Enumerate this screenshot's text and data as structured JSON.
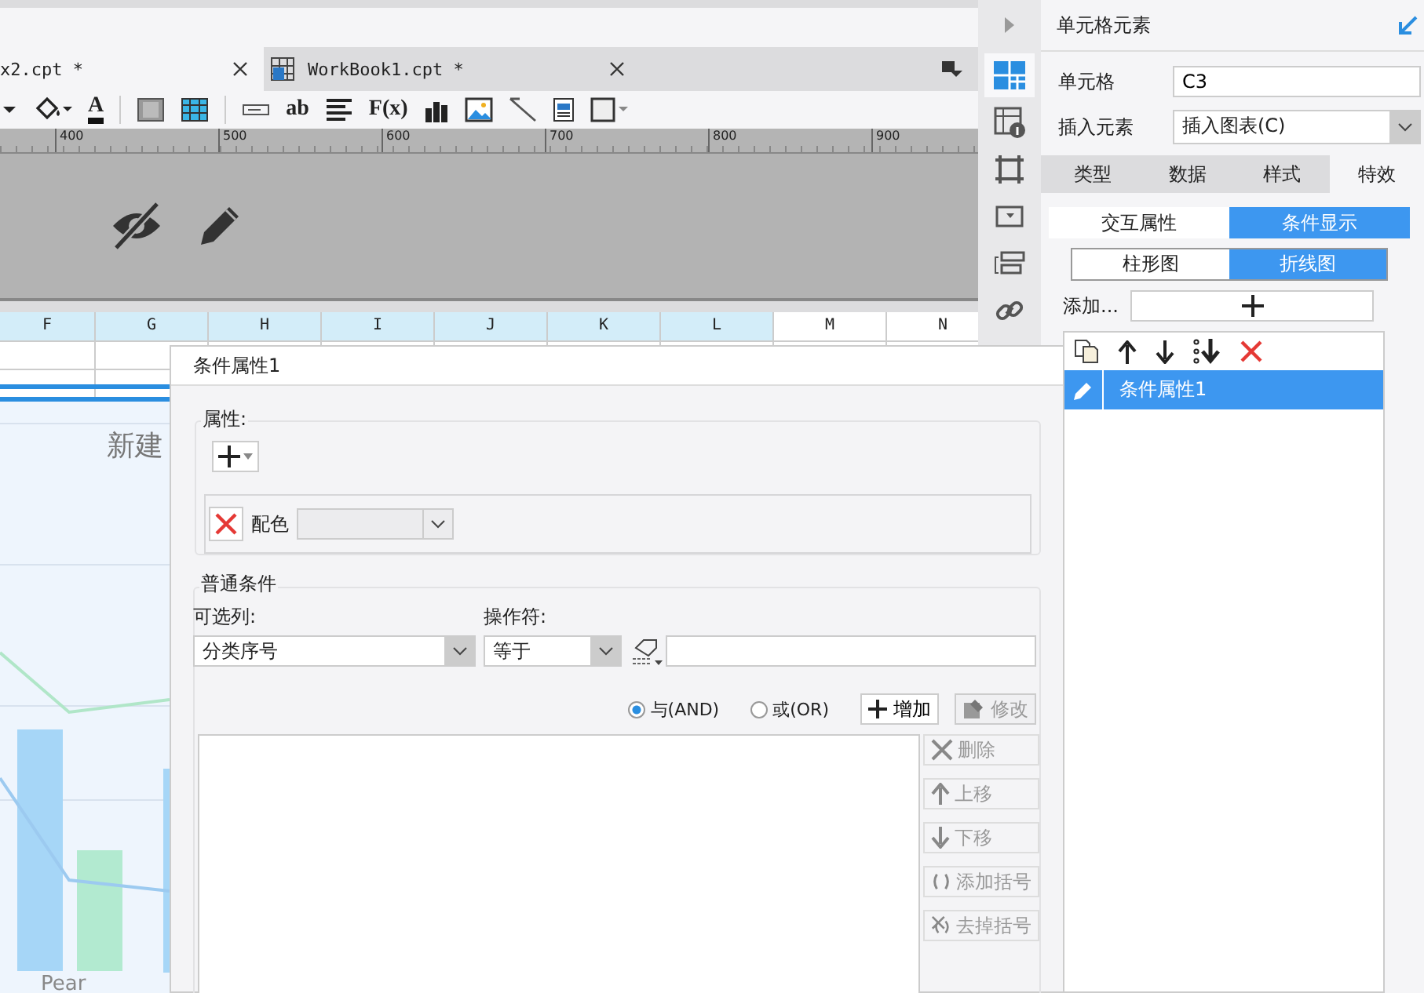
{
  "tabs": [
    {
      "label": "x2.cpt *",
      "selected": true
    },
    {
      "label": "WorkBook1.cpt *",
      "selected": false
    }
  ],
  "toolbar": [
    {
      "kind": "caret"
    },
    {
      "kind": "bucket"
    },
    {
      "kind": "text",
      "glyph": "A"
    },
    {
      "kind": "sep"
    },
    {
      "kind": "merge"
    },
    {
      "kind": "grid"
    },
    {
      "kind": "sep"
    },
    {
      "kind": "textfield"
    },
    {
      "kind": "text",
      "glyph": "ab"
    },
    {
      "kind": "align"
    },
    {
      "kind": "text",
      "glyph": "F(x)"
    },
    {
      "kind": "bars"
    },
    {
      "kind": "image"
    },
    {
      "kind": "slash"
    },
    {
      "kind": "doc"
    },
    {
      "kind": "border"
    }
  ],
  "ruler": [
    "400",
    "500",
    "600",
    "700",
    "800",
    "900"
  ],
  "columns": [
    {
      "label": "F",
      "selected": true
    },
    {
      "label": "G",
      "selected": true
    },
    {
      "label": "H",
      "selected": true
    },
    {
      "label": "I",
      "selected": true
    },
    {
      "label": "J",
      "selected": true
    },
    {
      "label": "K",
      "selected": true
    },
    {
      "label": "L",
      "selected": true
    },
    {
      "label": "M",
      "selected": false
    },
    {
      "label": "N",
      "selected": false
    }
  ],
  "chart": {
    "title": "新建",
    "category": "Pear"
  },
  "dialog": {
    "title": "条件属性1",
    "attributes": {
      "legend": "属性:",
      "color_label": "配色"
    },
    "condition": {
      "legend": "普通条件",
      "column_label": "可选列:",
      "column_value": "分类序号",
      "operator_label": "操作符:",
      "operator_value": "等于"
    },
    "logic": [
      {
        "label": "与(AND)",
        "selected": true
      },
      {
        "label": "或(OR)",
        "selected": false
      }
    ],
    "add_button": "增加",
    "modify_button": {
      "label": "修改",
      "disabled": true
    },
    "side_buttons": [
      {
        "kind": "delete",
        "label": "删除",
        "disabled": true
      },
      {
        "kind": "up",
        "label": "上移",
        "disabled": true
      },
      {
        "kind": "down",
        "label": "下移",
        "disabled": true
      },
      {
        "kind": "paren",
        "label": "添加括号",
        "disabled": true
      },
      {
        "kind": "unparen",
        "label": "去掉括号",
        "disabled": true
      }
    ]
  },
  "side_icons": [
    {
      "kind": "cell",
      "selected": true
    },
    {
      "kind": "info",
      "selected": false
    },
    {
      "kind": "frame",
      "selected": false
    },
    {
      "kind": "widget",
      "selected": false
    },
    {
      "kind": "layout",
      "selected": false
    },
    {
      "kind": "link",
      "selected": false
    }
  ],
  "panel": {
    "title": "单元格元素",
    "cell_label": "单元格",
    "cell_value": "C3",
    "insert_label": "插入元素",
    "insert_value": "插入图表(C)",
    "tabs": [
      {
        "label": "类型",
        "selected": false
      },
      {
        "label": "数据",
        "selected": false
      },
      {
        "label": "样式",
        "selected": false
      },
      {
        "label": "特效",
        "selected": true
      }
    ],
    "subtabs": [
      {
        "label": "交互属性",
        "selected": false
      },
      {
        "label": "条件显示",
        "selected": true
      }
    ],
    "chart_tabs": [
      {
        "label": "柱形图",
        "selected": false
      },
      {
        "label": "折线图",
        "selected": true
      }
    ],
    "add_label": "添加...",
    "items": [
      {
        "label": "条件属性1",
        "selected": true
      }
    ]
  }
}
